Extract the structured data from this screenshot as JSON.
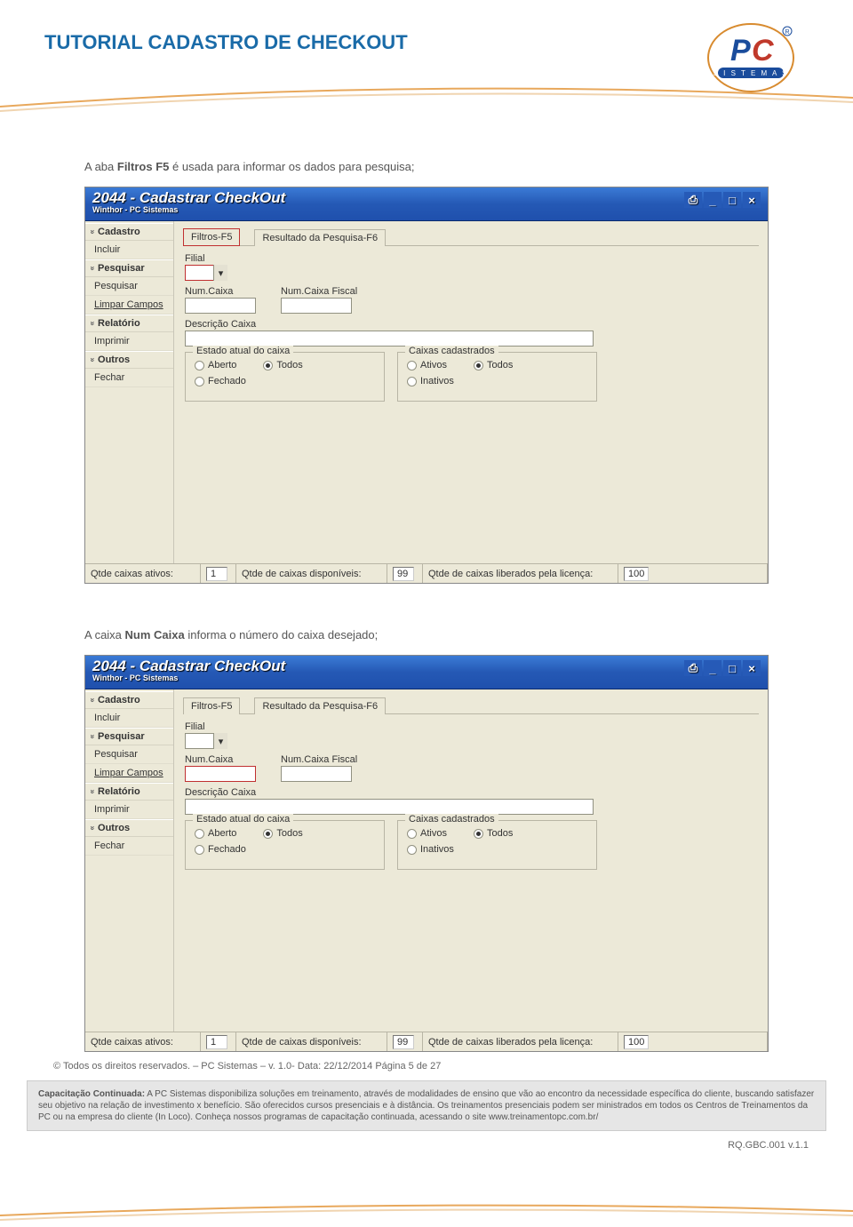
{
  "header": {
    "title": "TUTORIAL CADASTRO DE CHECKOUT",
    "logo_top": "PC",
    "logo_bottom": "SISTEMAS"
  },
  "paragraph1_pre": "A aba ",
  "paragraph1_bold": "Filtros F5",
  "paragraph1_post": " é usada para informar os dados para pesquisa;",
  "paragraph2_pre": "A caixa ",
  "paragraph2_bold": "Num Caixa",
  "paragraph2_post": " informa o número do caixa desejado;",
  "window": {
    "title": "2044 - Cadastrar CheckOut",
    "subtitle": "Winthor - PC Sistemas",
    "titlebar_icons": {
      "settings": "⎙",
      "min": "_",
      "max": "□",
      "close": "×"
    },
    "side": {
      "cadastro": "Cadastro",
      "incluir": "Incluir",
      "pesquisar_hdr": "Pesquisar",
      "pesquisar": "Pesquisar",
      "limpar": "Limpar Campos",
      "relatorio": "Relatório",
      "imprimir": "Imprimir",
      "outros": "Outros",
      "fechar": "Fechar"
    },
    "tabs": {
      "filtros": "Filtros-F5",
      "resultado": "Resultado da Pesquisa-F6"
    },
    "form": {
      "filial": "Filial",
      "numcaixa": "Num.Caixa",
      "numcaixafiscal": "Num.Caixa Fiscal",
      "descricao": "Descrição Caixa",
      "estado_title": "Estado atual do caixa",
      "aberto": "Aberto",
      "fechado": "Fechado",
      "todos": "Todos",
      "caixas_title": "Caixas cadastrados",
      "ativos": "Ativos",
      "inativos": "Inativos"
    },
    "status": {
      "l1": "Qtde caixas ativos:",
      "v1": "1",
      "l2": "Qtde de caixas disponíveis:",
      "v2": "99",
      "l3": "Qtde de caixas liberados pela licença:",
      "v3": "100"
    }
  },
  "copyright": "© Todos os direitos reservados. – PC Sistemas – v. 1.0- Data: 22/12/2014 Página 5 de 27",
  "footer": {
    "bold": "Capacitação Continuada:",
    "text": " A PC Sistemas disponibiliza soluções em treinamento, através de modalidades de ensino que vão ao encontro da necessidade específica do cliente, buscando satisfazer seu objetivo na relação de investimento x benefício. São oferecidos cursos presenciais e à distância. Os treinamentos presenciais podem ser ministrados em todos os Centros de Treinamentos da PC ou na empresa do cliente (In Loco). Conheça nossos programas de capacitação continuada, acessando o site www.treinamentopc.com.br/"
  },
  "rq": "RQ.GBC.001 v.1.1"
}
